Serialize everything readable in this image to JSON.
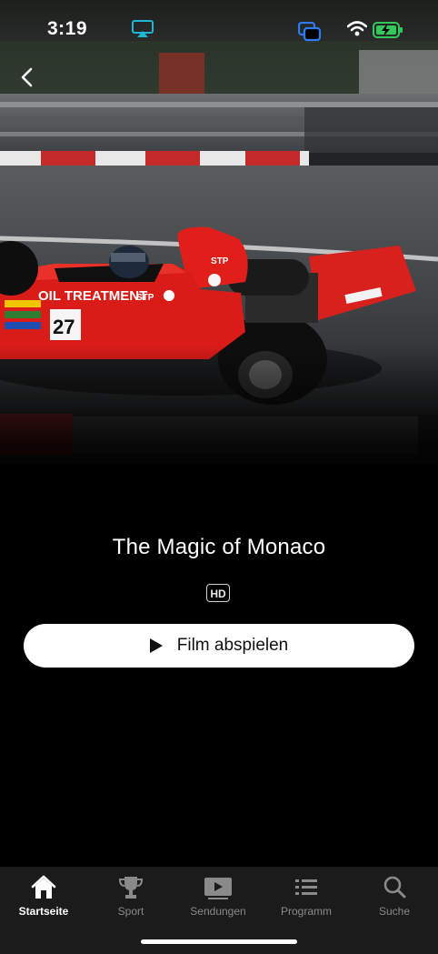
{
  "status_bar": {
    "time": "3:19",
    "icons": [
      "airplay-icon",
      "screen-mirroring-icon",
      "wifi-icon",
      "battery-charging-icon"
    ],
    "airplay_color": "#1fb5d6",
    "mirroring_color": "#2f7bf5",
    "battery_color": "#34c759"
  },
  "nav": {
    "back_icon": "chevron-left-icon"
  },
  "hero": {
    "image": "red-formula-car-racing-photo",
    "car_number": "27",
    "car_text": "OIL TREATMENT",
    "sponsor": "STP"
  },
  "content": {
    "title": "The Magic of Monaco",
    "quality_badge": "HD",
    "play_button_label": "Film abspielen"
  },
  "tabbar": {
    "items": [
      {
        "label": "Startseite",
        "icon": "home-icon",
        "active": true
      },
      {
        "label": "Sport",
        "icon": "trophy-icon",
        "active": false
      },
      {
        "label": "Sendungen",
        "icon": "play-box-icon",
        "active": false
      },
      {
        "label": "Programm",
        "icon": "list-icon",
        "active": false
      },
      {
        "label": "Suche",
        "icon": "search-icon",
        "active": false
      }
    ]
  }
}
